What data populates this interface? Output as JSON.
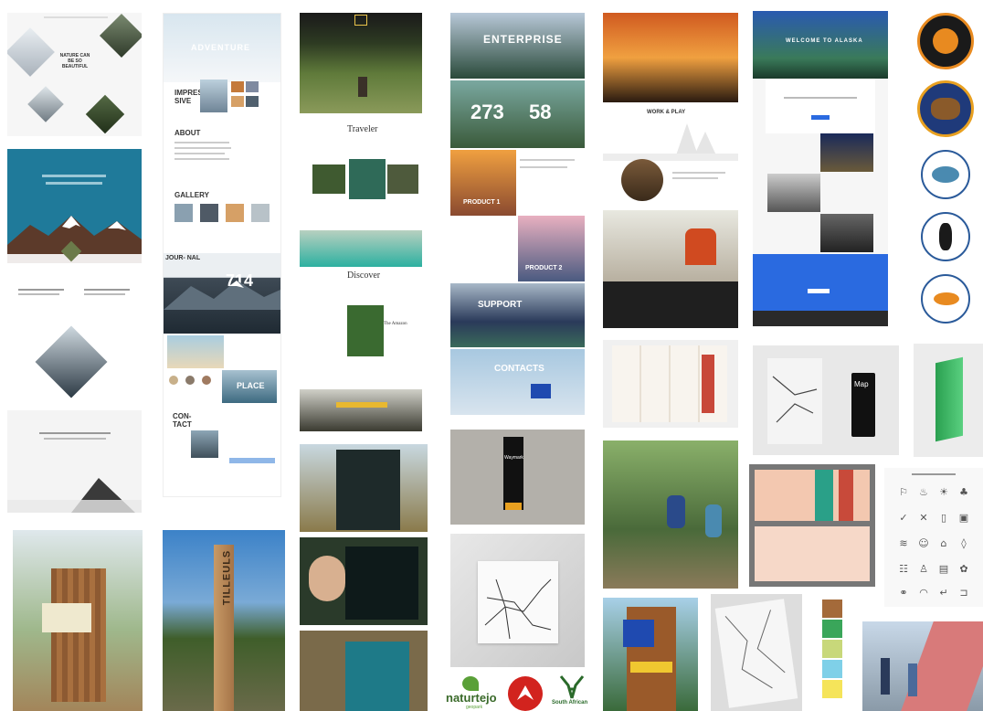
{
  "col1": {
    "tile1_heading": "NATURE CAN BE SO BEAUTIFUL"
  },
  "col2": {
    "adventure": "ADVENTURE",
    "impressive": "IMPRES- SIVE",
    "about": "ABOUT",
    "gallery": "GALLERY",
    "journal": "JOUR- NAL",
    "journal_number": "714",
    "place": "PLACE",
    "contact": "CON- TACT",
    "tilleuls": "TILLEULS"
  },
  "col3": {
    "traveler": "Traveler",
    "discover": "Discover",
    "the_amazon": "The Amazon"
  },
  "col4": {
    "enterprise": "ENTERPRISE",
    "stat1": "273",
    "stat2": "58",
    "product1": "PRODUCT 1",
    "product2": "PRODUCT 2",
    "support": "SUPPORT",
    "contacts": "CONTACTS",
    "wayfinding": "Waymark"
  },
  "col5": {
    "work_play": "WORK & PLAY"
  },
  "col6": {
    "welcome": "WELCOME TO ALASKA",
    "map_label": "Map"
  },
  "logos": {
    "naturtejo": "naturtejo",
    "naturtejo_sub": "geopark",
    "south_african": "South African"
  },
  "palette": [
    "#a46a3a",
    "#3aa65a",
    "#c8d87a",
    "#7fd0e8",
    "#f5e45a"
  ],
  "icons": [
    "hike-icon",
    "fire-icon",
    "sun-icon",
    "tree-icon",
    "bird-icon",
    "tent-icon",
    "bench-icon",
    "camera-icon",
    "wifi-icon",
    "person-icon",
    "lock-icon",
    "drop-icon",
    "grid-icon",
    "trash-icon",
    "toilet-icon",
    "paw-icon",
    "bike-icon",
    "shoe-icon",
    "arrow-icon",
    "door-icon"
  ]
}
